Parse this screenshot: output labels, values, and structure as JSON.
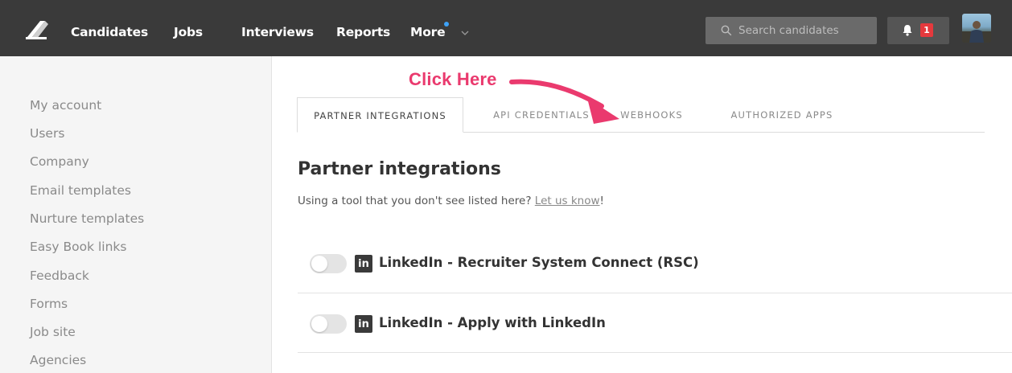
{
  "nav": {
    "items": [
      {
        "label": "Candidates"
      },
      {
        "label": "Jobs"
      },
      {
        "label": "Interviews"
      },
      {
        "label": "Reports"
      },
      {
        "label": "More"
      }
    ],
    "search_placeholder": "Search candidates",
    "notification_count": "1",
    "accent_dot_color": "#3ea2f7",
    "badge_color": "#e5393d"
  },
  "sidebar": {
    "items": [
      {
        "label": "My account"
      },
      {
        "label": "Users"
      },
      {
        "label": "Company"
      },
      {
        "label": "Email templates"
      },
      {
        "label": "Nurture templates"
      },
      {
        "label": "Easy Book links"
      },
      {
        "label": "Feedback"
      },
      {
        "label": "Forms"
      },
      {
        "label": "Job site"
      },
      {
        "label": "Agencies"
      }
    ]
  },
  "tabs": [
    {
      "label": "PARTNER INTEGRATIONS",
      "active": true
    },
    {
      "label": "API CREDENTIALS",
      "active": false
    },
    {
      "label": "WEBHOOKS",
      "active": false
    },
    {
      "label": "AUTHORIZED APPS",
      "active": false
    }
  ],
  "annotation": {
    "label": "Click Here",
    "color": "#ea3a6e"
  },
  "main": {
    "title": "Partner integrations",
    "subtitle_prefix": "Using a tool that you don't see listed here? ",
    "subtitle_link": "Let us know",
    "subtitle_suffix": "!",
    "integrations": [
      {
        "icon": "linkedin-icon",
        "icon_text": "in",
        "name": "LinkedIn - Recruiter System Connect (RSC)",
        "enabled": false
      },
      {
        "icon": "linkedin-icon",
        "icon_text": "in",
        "name": "LinkedIn - Apply with LinkedIn",
        "enabled": false
      }
    ]
  }
}
